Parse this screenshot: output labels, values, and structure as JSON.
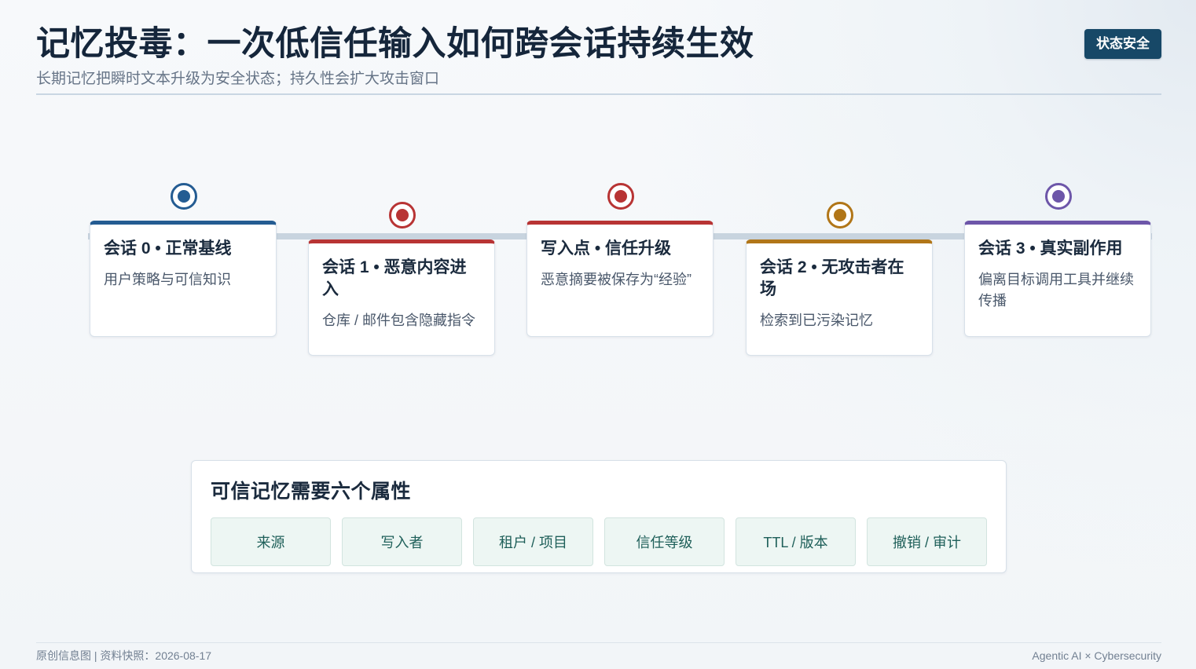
{
  "header": {
    "title": "记忆投毒：一次低信任输入如何跨会话持续生效",
    "subtitle": "长期记忆把瞬时文本升级为安全状态；持久性会扩大攻击窗口",
    "status_badge": "状态安全"
  },
  "timeline": {
    "stages": [
      {
        "title": "会话 0 • 正常基线",
        "description": "用户策略与可信知识",
        "accent_color": "#245c92"
      },
      {
        "title": "会话 1 • 恶意内容进入",
        "description": "仓库 / 邮件包含隐藏指令",
        "accent_color": "#b83434"
      },
      {
        "title": "写入点 • 信任升级",
        "description": "恶意摘要被保存为“经验”",
        "accent_color": "#b83434"
      },
      {
        "title": "会话 2 • 无攻击者在场",
        "description": "检索到已污染记忆",
        "accent_color": "#b17618"
      },
      {
        "title": "会话 3 • 真实副作用",
        "description": "偏离目标调用工具并继续传播",
        "accent_color": "#6d56a9"
      }
    ]
  },
  "attributes": {
    "title": "可信记忆需要六个属性",
    "items": [
      "来源",
      "写入者",
      "租户 / 项目",
      "信任等级",
      "TTL / 版本",
      "撤销 / 审计"
    ]
  },
  "footer": {
    "left": "原创信息图 | 资料快照：2026-08-17",
    "right": "Agentic AI × Cybersecurity"
  },
  "colors": {
    "title": "#15263b",
    "badge": "#174867",
    "line": "#c8d4df",
    "attribute_chip": "#edf6f3",
    "attribute_text": "#1e5f59"
  }
}
